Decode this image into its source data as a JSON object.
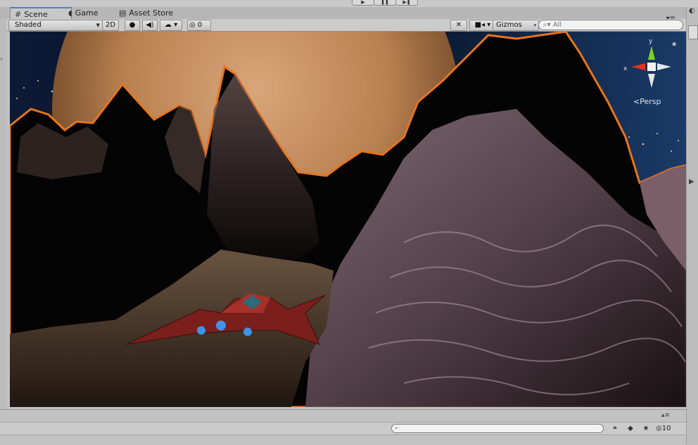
{
  "tabs": [
    {
      "label": "Scene",
      "icon": "hash-icon",
      "active": true
    },
    {
      "label": "Game",
      "icon": "pacman-icon",
      "active": false
    },
    {
      "label": "Asset Store",
      "icon": "store-icon",
      "active": false
    }
  ],
  "toolbar": {
    "draw_mode": "Shaded",
    "mode_2d": "2D",
    "hidden_count": "0",
    "gizmos_label": "Gizmos",
    "search_placeholder": "All"
  },
  "scene_gizmo": {
    "x_label": "x",
    "y_label": "y",
    "projection_label": "Persp"
  },
  "bottom_bar": {
    "hidden_count": "10"
  },
  "colors": {
    "selection_outline": "#e8741e",
    "tab_accent": "#4a80c8"
  }
}
